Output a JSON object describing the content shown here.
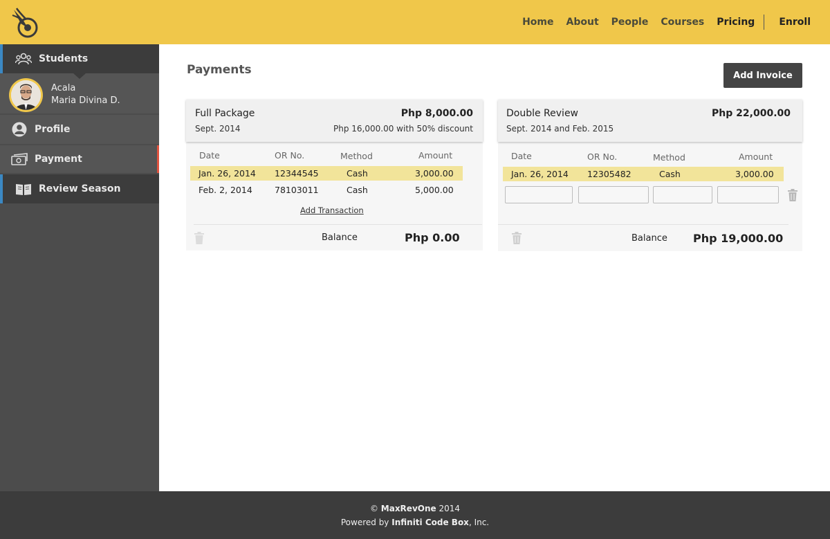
{
  "nav": {
    "items": [
      "Home",
      "About",
      "People",
      "Courses",
      "Pricing"
    ],
    "active": "Pricing",
    "enroll": "Enroll"
  },
  "sidebar": {
    "students_label": "Students",
    "student": {
      "last_name": "Acala",
      "first_name": "Maria Divina D."
    },
    "profile_label": "Profile",
    "payment_label": "Payment",
    "review_label": "Review Season"
  },
  "main": {
    "title": "Payments",
    "add_invoice_label": "Add Invoice"
  },
  "invoices": [
    {
      "name": "Full Package",
      "period": "Sept. 2014",
      "price": "Php 8,000.00",
      "discount_note": "Php 16,000.00 with 50% discount",
      "headers": {
        "date": "Date",
        "or": "OR No.",
        "method": "Method",
        "amount": "Amount"
      },
      "rows": [
        {
          "date": "Jan. 26, 2014",
          "or": "12344545",
          "method": "Cash",
          "amount": "3,000.00",
          "highlighted": true
        },
        {
          "date": "Feb. 2, 2014",
          "or": "78103011",
          "method": "Cash",
          "amount": "5,000.00",
          "highlighted": false
        }
      ],
      "add_transaction_label": "Add Transaction",
      "balance_label": "Balance",
      "balance_value": "Php 0.00"
    },
    {
      "name": "Double Review",
      "period": "Sept. 2014 and Feb. 2015",
      "price": "Php 22,000.00",
      "headers": {
        "date": "Date",
        "or": "OR No.",
        "method": "Method",
        "amount": "Amount"
      },
      "rows": [
        {
          "date": "Jan. 26, 2014",
          "or": "12305482",
          "method": "Cash",
          "amount": "3,000.00",
          "highlighted": true
        }
      ],
      "new_row_inputs": {
        "date": "",
        "or": "",
        "method": "",
        "amount": ""
      },
      "balance_label": "Balance",
      "balance_value": "Php 19,000.00"
    }
  ],
  "footer": {
    "copyright_symbol": "©",
    "brand": "MaxRevOne",
    "year": "2014",
    "powered_prefix": "Powered by",
    "company": "Infiniti Code Box",
    "company_suffix": ", Inc."
  },
  "colors": {
    "header_bg": "#f0c74a",
    "sidebar_bg": "#4c4c4c",
    "accent_blue": "#3b88c3",
    "accent_red": "#e0533f",
    "highlight_row": "#f2e49a",
    "footer_bg": "#3c3c3c"
  }
}
